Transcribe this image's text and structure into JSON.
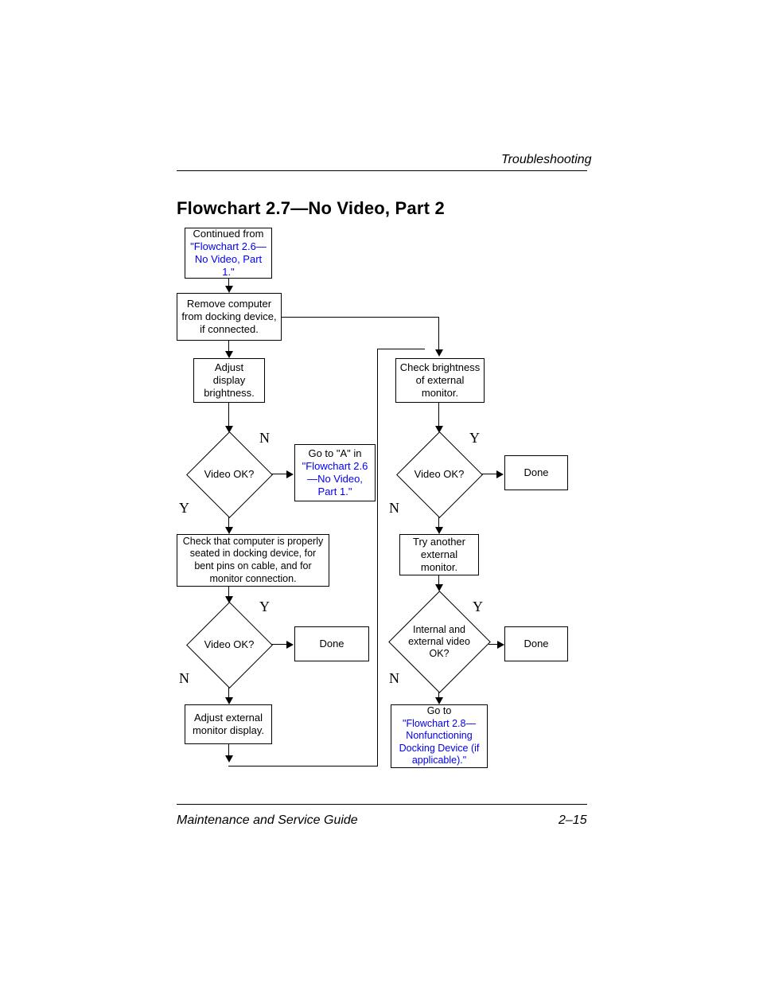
{
  "header": {
    "section": "Troubleshooting"
  },
  "title": "Flowchart 2.7—No Video, Part 2",
  "footer": {
    "left": "Maintenance and Service Guide",
    "right": "2–15"
  },
  "nodes": {
    "cont_pre": "Continued from",
    "cont_link": "\"Flowchart 2.6—No Video, Part 1.\"",
    "remove": "Remove computer from docking device, if connected.",
    "adjust_brightness": "Adjust display brightness.",
    "check_ext_brightness": "Check brightness of external monitor.",
    "video_ok": "Video OK?",
    "goto_a_pre": "Go to \"A\" in",
    "goto_a_link": "\"Flowchart 2.6—No Video, Part 1.\"",
    "done": "Done",
    "check_seated": "Check that computer is properly seated in docking device, for bent pins on cable, and for monitor connection.",
    "try_another": "Try another external monitor.",
    "internal_ext_ok": "Internal and external video OK?",
    "adjust_ext": "Adjust external monitor display.",
    "goto28_pre": "Go to",
    "goto28_link": "\"Flowchart 2.8—Nonfunctioning Docking Device (if applicable).\""
  },
  "labels": {
    "Y": "Y",
    "N": "N"
  }
}
